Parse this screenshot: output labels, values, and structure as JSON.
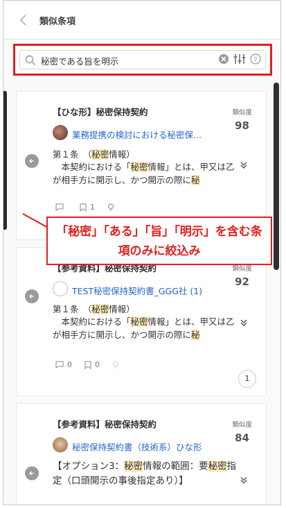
{
  "header": {
    "back_icon": "chevron-left-icon",
    "title": "類似条項"
  },
  "search": {
    "value": "秘密である旨を明示",
    "icons": [
      "search-icon",
      "clear-icon",
      "filter-sliders-icon",
      "help-icon"
    ]
  },
  "cards": [
    {
      "title": "【ひな形】秘密保持契約",
      "similarity_label": "類似度",
      "similarity": "98",
      "document": "業務提携の検討における秘密保...",
      "clause_head": "第１条　（秘密情報）",
      "clause_body": "　本契約における「秘密情報」とは、甲又は乙が相手方に開示し、かつ開示の際に秘密である旨を明示した技術上又は営業上の",
      "comments": "",
      "bookmarks": "1"
    },
    {
      "title": "【参考資料】秘密保持契約",
      "similarity_label": "類似度",
      "similarity": "92",
      "document": "TEST秘密保持契約書_GGG社 (1)",
      "clause_head": "第１条　（秘密情報）",
      "clause_body": "　本契約における「秘密情報」とは、甲又は乙が相手方に開示し、かつ開示の際に秘密である旨を明示した技術上又は営業上の",
      "comments": "0",
      "bookmarks": "0",
      "count": "1"
    },
    {
      "title": "【参考資料】秘密保持契約",
      "similarity_label": "類似度",
      "similarity": "84",
      "document": "秘密保持契約書（技術系）ひな形",
      "clause_body": "【オプション3：秘密情報の範囲：要秘密指定（口頭開示の事後指定あり）】"
    }
  ],
  "callout": {
    "text": "「秘密」「ある」「旨」「明示」を含む条項のみに絞込み"
  },
  "colors": {
    "accent_red": "#e0201c",
    "link_blue": "#2266cc",
    "highlight": "#fbe8b4"
  }
}
